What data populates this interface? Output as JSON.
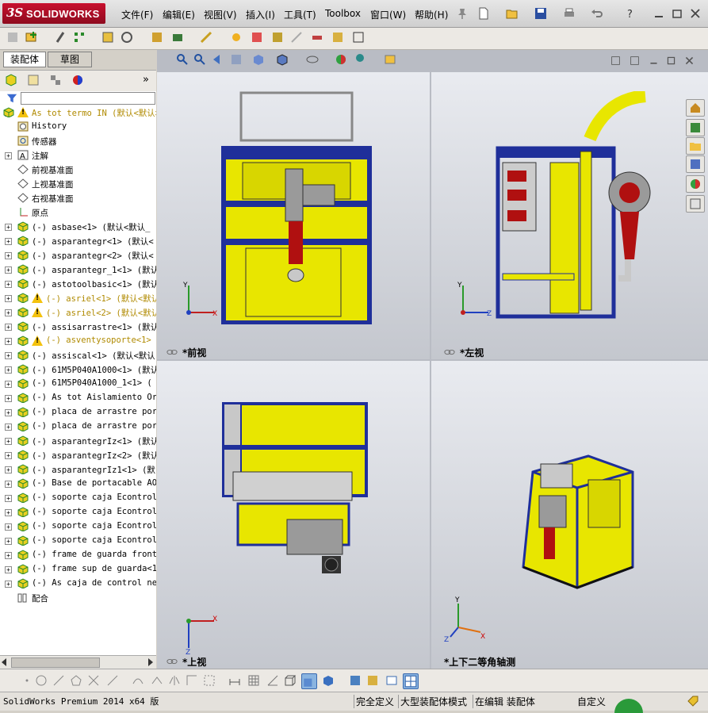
{
  "app": {
    "name": "SOLIDWORKS",
    "logo_mark": "3S",
    "menus": [
      "文件(F)",
      "编辑(E)",
      "视图(V)",
      "插入(I)",
      "工具(T)",
      "Toolbox",
      "窗口(W)",
      "帮助(H)"
    ]
  },
  "left_panel": {
    "tabs": [
      "装配体",
      "草图"
    ],
    "collapse_glyph": "»",
    "tree": [
      {
        "label": "As tot termo IN  (默认<默认>",
        "icon": "assembly",
        "warning": true,
        "expand": "minus",
        "level": 0
      },
      {
        "label": "History",
        "icon": "history",
        "level": 1
      },
      {
        "label": "传感器",
        "icon": "sensor",
        "level": 1
      },
      {
        "label": "注解",
        "icon": "annotation",
        "expand": "plus",
        "level": 1
      },
      {
        "label": "前视基准面",
        "icon": "plane",
        "level": 1
      },
      {
        "label": "上视基准面",
        "icon": "plane",
        "level": 1
      },
      {
        "label": "右视基准面",
        "icon": "plane",
        "level": 1
      },
      {
        "label": "原点",
        "icon": "origin",
        "level": 1
      },
      {
        "label": "(-) asbase<1> (默认<默认_",
        "icon": "assembly",
        "expand": "plus",
        "level": 1
      },
      {
        "label": "(-) asparantegr<1> (默认<",
        "icon": "assembly",
        "expand": "plus",
        "level": 1
      },
      {
        "label": "(-) asparantegr<2> (默认<",
        "icon": "assembly",
        "expand": "plus",
        "level": 1
      },
      {
        "label": "(-) asparantegr_1<1> (默认",
        "icon": "assembly",
        "expand": "plus",
        "level": 1
      },
      {
        "label": "(-) astotoolbasic<1> (默认",
        "icon": "assembly",
        "expand": "plus",
        "level": 1
      },
      {
        "label": "(-) asriel<1> (默认<默认",
        "icon": "assembly",
        "warning": true,
        "expand": "plus",
        "level": 1
      },
      {
        "label": "(-) asriel<2> (默认<默认",
        "icon": "assembly",
        "warning": true,
        "expand": "plus",
        "level": 1
      },
      {
        "label": "(-) assisarrastre<1> (默认",
        "icon": "assembly",
        "expand": "plus",
        "level": 1
      },
      {
        "label": "(-) asventysoporte<1>",
        "icon": "assembly",
        "warning": true,
        "expand": "plus",
        "level": 1
      },
      {
        "label": "(-) assiscal<1> (默认<默认",
        "icon": "assembly",
        "expand": "plus",
        "level": 1
      },
      {
        "label": "(-) 61M5P040A1000<1> (默认",
        "icon": "assembly",
        "expand": "plus",
        "level": 1
      },
      {
        "label": "(-) 61M5P040A1000_1<1> (",
        "icon": "assembly",
        "expand": "plus",
        "level": 1
      },
      {
        "label": "(-) As tot Aislamiento Ort",
        "icon": "assembly",
        "expand": "plus",
        "level": 1
      },
      {
        "label": "(-) placa de arrastre porv",
        "icon": "assembly",
        "expand": "plus",
        "level": 1
      },
      {
        "label": "(-) placa de arrastre porv",
        "icon": "assembly",
        "expand": "plus",
        "level": 1
      },
      {
        "label": "(-) asparantegrIz<1> (默认",
        "icon": "assembly",
        "expand": "plus",
        "level": 1
      },
      {
        "label": "(-) asparantegrIz<2> (默认",
        "icon": "assembly",
        "expand": "plus",
        "level": 1
      },
      {
        "label": "(-) asparantegrIz1<1> (默",
        "icon": "assembly",
        "expand": "plus",
        "level": 1
      },
      {
        "label": "(-) Base de portacable AO-",
        "icon": "assembly",
        "expand": "plus",
        "level": 1
      },
      {
        "label": "(-) soporte caja Econtrol-",
        "icon": "assembly",
        "expand": "plus",
        "level": 1
      },
      {
        "label": "(-) soporte caja Econtrol1",
        "icon": "assembly",
        "expand": "plus",
        "level": 1
      },
      {
        "label": "(-) soporte caja Econtrol1",
        "icon": "assembly",
        "expand": "plus",
        "level": 1
      },
      {
        "label": "(-) soporte caja Econtrol-",
        "icon": "assembly",
        "expand": "plus",
        "level": 1
      },
      {
        "label": "(-) frame de guarda fronta",
        "icon": "assembly",
        "expand": "plus",
        "level": 1
      },
      {
        "label": "(-) frame sup de guarda<1>",
        "icon": "assembly",
        "expand": "plus",
        "level": 1
      },
      {
        "label": "(-) As caja de control nev",
        "icon": "assembly",
        "expand": "plus",
        "level": 1
      },
      {
        "label": "配合",
        "icon": "mates",
        "level": 1
      }
    ]
  },
  "viewports": [
    {
      "id": "front",
      "label": "*前视",
      "axes": [
        "Y",
        "X"
      ]
    },
    {
      "id": "left",
      "label": "*左视",
      "axes": [
        "Y",
        "Z"
      ]
    },
    {
      "id": "top",
      "label": "*上视",
      "axes": [
        "X",
        "Z"
      ]
    },
    {
      "id": "iso",
      "label": "*上下二等角轴测",
      "axes": [
        "Y",
        "X",
        "Z"
      ]
    }
  ],
  "status": {
    "product": "SolidWorks Premium 2014 x64 版",
    "fully_defined": "完全定义",
    "large_assembly": "大型装配体模式",
    "editing": "在编辑 装配体",
    "custom": "自定义"
  },
  "colors": {
    "frame_blue": "#1f2f9a",
    "panel_yellow": "#e8e600",
    "duct_red": "#b01010",
    "grey_part": "#9a9a9a",
    "brand_red": "#c8102e"
  }
}
